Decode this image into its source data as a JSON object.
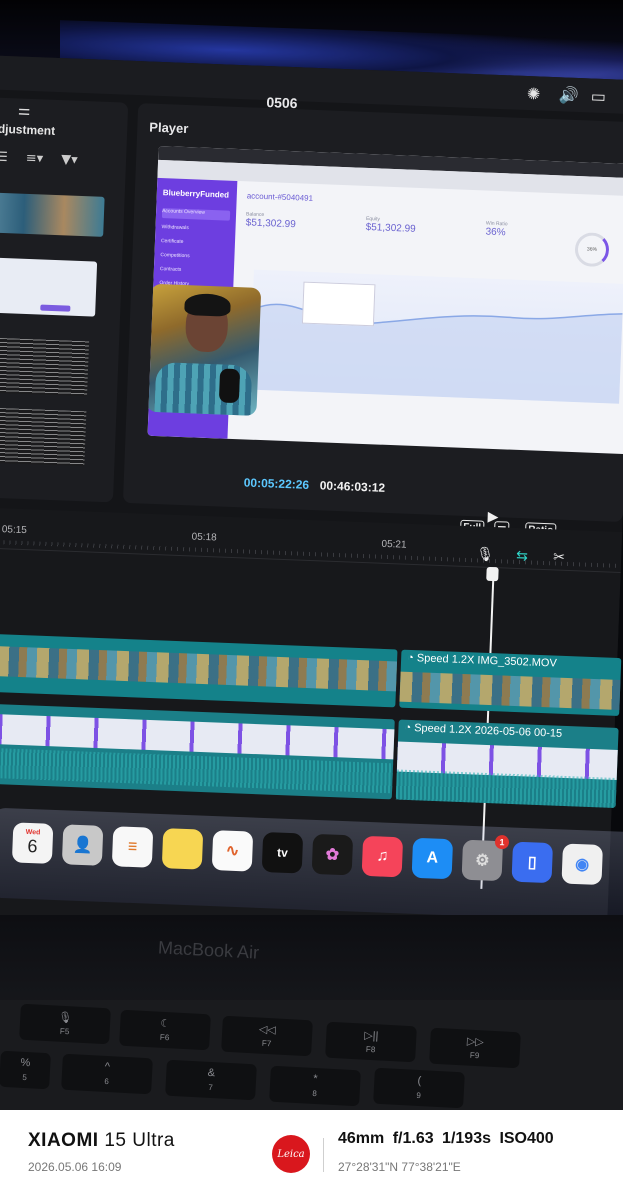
{
  "screen": {
    "project_title": "0506",
    "adjustment_label": "Adjustment",
    "player_label": "Player",
    "recorded_browser": {
      "brand": "BlueberryFunded",
      "nav": [
        "Accounts Overview",
        "Withdrawals",
        "Certificate",
        "Competitions",
        "Contracts",
        "Order History"
      ],
      "account": "account-#5040491",
      "balance_label": "Balance",
      "balance_value": "$51,302.99",
      "equity_label": "Equity",
      "equity_value": "$51,302.99",
      "win_ratio_label": "Win Ratio",
      "win_ratio_value": "36%",
      "ring_value": "36%"
    },
    "timecode_current": "00:05:22:26",
    "timecode_total": "00:46:03:12",
    "controls": {
      "full": "Full",
      "ratio": "Ratio"
    },
    "ruler_ticks": [
      "05:15",
      "05:18",
      "05:21"
    ],
    "clips": {
      "video_speed": "Speed 1.2X",
      "video_name": "IMG_3502.MOV",
      "screen_speed": "Speed 1.2X",
      "screen_name": "2026-05-06 00-15"
    },
    "dock": {
      "calendar_day": "Wed",
      "calendar_date": "6",
      "settings_badge": "1",
      "apps": [
        "calendar",
        "contacts",
        "reminders",
        "notes",
        "freeform",
        "tv",
        "photos",
        "music",
        "app-store",
        "system-settings",
        "simulator",
        "chrome"
      ]
    },
    "laptop_label": "MacBook Air",
    "keys": [
      {
        "sym": "🎙",
        "fn": "F5"
      },
      {
        "sym": "☾",
        "fn": "F6"
      },
      {
        "sym": "◁◁",
        "fn": "F7"
      },
      {
        "sym": "▷||",
        "fn": "F8"
      },
      {
        "sym": "▷▷",
        "fn": "F9"
      },
      {
        "sym": "%",
        "fn": "5"
      },
      {
        "sym": "^",
        "fn": "6"
      },
      {
        "sym": "&",
        "fn": "7"
      },
      {
        "sym": "*",
        "fn": "8"
      },
      {
        "sym": "(",
        "fn": "9"
      }
    ]
  },
  "footer": {
    "brand": "XIAOMI",
    "model": "15 Ultra",
    "datetime": "2026.05.06 16:09",
    "lens_logo": "Leica",
    "exif": "46mm  f/1.63  1/193s  ISO400",
    "gps": "27°28'31\"N  77°38'21\"E"
  },
  "colors": {
    "accent_timecode": "#5cc8ff",
    "clip_teal": "#14828a",
    "leica_red": "#d9171d",
    "brand_purple": "#6d3ee0"
  }
}
